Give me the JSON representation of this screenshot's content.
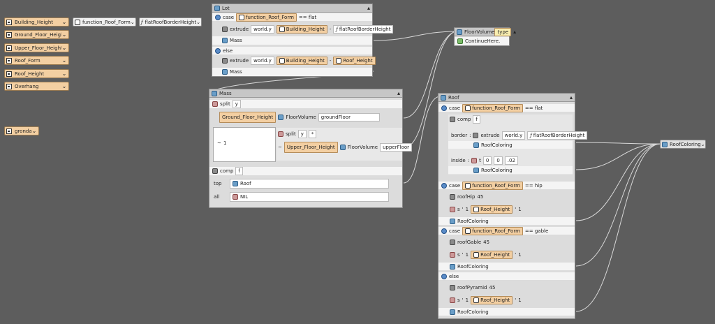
{
  "params": [
    "Building_Height",
    "Ground_Floor_Height",
    "Upper_Floor_Height",
    "Roof_Form",
    "Roof_Height",
    "Overhang"
  ],
  "param_extra": "gronda",
  "func_node": {
    "label": "function_Roof_Form"
  },
  "func_param": {
    "label": "flatRoofBorderHeight"
  },
  "lot": {
    "title": "Lot",
    "case_kw": "case",
    "case_func": "function_Roof_Form",
    "case_eq": "== flat",
    "extrude": "extrude",
    "world_y": "world.y",
    "building_height": "Building_Height",
    "minus": "-",
    "flat_border": "flatRoofBorderHeight",
    "mass": "Mass",
    "else_kw": "else",
    "roof_height": "Roof_Height"
  },
  "floor_volume": {
    "title": "FloorVolume",
    "tag": "type",
    "continue": "ContinueHere."
  },
  "mass": {
    "title": "Mass",
    "split": "split",
    "axis_y": "y",
    "ground_floor_height": "Ground_Floor_Height",
    "floor_volume": "FloorVolume",
    "ground_floor": "groundFloor",
    "tilde": "~",
    "one": "1",
    "star": "*",
    "upper_floor_height": "Upper_Floor_Height",
    "upper_floor": "upperFloor",
    "comp": "comp",
    "comp_f": "f",
    "top": "top",
    "roof": "Roof",
    "all": "all",
    "nil": "NIL"
  },
  "roof": {
    "title": "Roof",
    "case_kw": "case",
    "func": "function_Roof_Form",
    "eq_flat": "== flat",
    "comp": "comp",
    "comp_f": "f",
    "border": "border",
    "colon": ":",
    "extrude": "extrude",
    "world_y": "world.y",
    "flat_border": "flatRoofBorderHeight",
    "roof_coloring": "RoofColoring",
    "inside": "inside",
    "t": "t",
    "t0a": "0",
    "t0b": "0",
    "t02": ".02",
    "eq_hip": "== hip",
    "roof_hip": "roofHip",
    "angle45": "45",
    "s": "s",
    "q": "'",
    "one": "1",
    "roof_height": "Roof_Height",
    "eq_gable": "== gable",
    "roof_gable": "roofGable",
    "else_kw": "else",
    "roof_pyramid": "roofPyramid"
  },
  "roof_coloring_node": "RoofColoring"
}
